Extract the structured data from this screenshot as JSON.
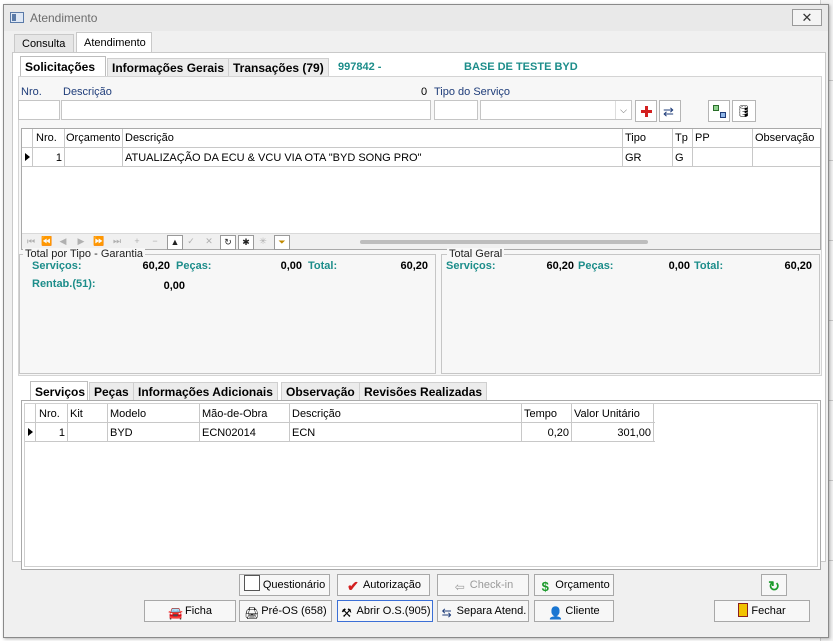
{
  "window": {
    "title": "Atendimento",
    "close_glyph": "✕"
  },
  "top_tabs": {
    "consulta": "Consulta",
    "atendimento": "Atendimento"
  },
  "inner_tabs": {
    "solicitacoes": "Solicitações",
    "info_gerais": "Informações Gerais",
    "transacoes": "Transações (79)"
  },
  "header_info": {
    "code": "997842 -",
    "base": "BASE DE TESTE BYD"
  },
  "form": {
    "nro_label": "Nro.",
    "descricao_label": "Descrição",
    "zero": "0",
    "tipo_servico_label": "Tipo do Serviço"
  },
  "grid1": {
    "headers": [
      "Nro.",
      "Orçamento",
      "Descrição",
      "Tipo",
      "Tp",
      "PP",
      "Observação"
    ],
    "rows": [
      {
        "nro": "1",
        "orcamento": "",
        "descricao": "ATUALIZAÇÃO DA ECU & VCU VIA OTA \"BYD SONG PRO\"",
        "tipo": "GR",
        "tp": "G",
        "pp": "",
        "obs": ""
      }
    ],
    "nav": [
      "⏮",
      "⏪",
      "◀",
      "▶",
      "⏩",
      "⏭",
      "+",
      "−",
      "▲",
      "✓",
      "✕",
      "↻",
      "✱",
      "✳",
      "⏷"
    ]
  },
  "totals_left": {
    "title": "Total por Tipo - Garantia",
    "servicos_label": "Serviços:",
    "servicos": "60,20",
    "pecas_label": "Peças:",
    "pecas": "0,00",
    "total_label": "Total:",
    "total": "60,20",
    "rentab_label": "Rentab.(51):",
    "rentab": "0,00"
  },
  "totals_right": {
    "title": "Total Geral",
    "servicos_label": "Serviços:",
    "servicos": "60,20",
    "pecas_label": "Peças:",
    "pecas": "0,00",
    "total_label": "Total:",
    "total": "60,20"
  },
  "lower_tabs": {
    "servicos": "Serviços",
    "pecas": "Peças",
    "info_adicionais": "Informações Adicionais",
    "observacao": "Observação",
    "revisoes": "Revisões Realizadas"
  },
  "grid2": {
    "headers": [
      "Nro.",
      "Kit",
      "Modelo",
      "Mão-de-Obra",
      "Descrição",
      "Tempo",
      "Valor Unitário"
    ],
    "rows": [
      {
        "nro": "1",
        "kit": "",
        "modelo": "BYD",
        "mao_obra": "ECN02014",
        "descricao": "ECN",
        "tempo": "0,20",
        "valor": "301,00"
      }
    ]
  },
  "buttons": {
    "questionario": "Questionário",
    "autorizacao": "Autorização",
    "checkin": "Check-in",
    "orcamento": "Orçamento",
    "ficha": "Ficha",
    "pre_os": "Pré-OS (658)",
    "abrir_os": "Abrir O.S.(905)",
    "separa": "Separa Atend.",
    "cliente": "Cliente",
    "fechar": "Fechar"
  },
  "colors": {
    "teal": "#1c8d8a",
    "label_blue": "#1f3d7a",
    "red": "#d32020",
    "green": "#1a9a2a"
  }
}
